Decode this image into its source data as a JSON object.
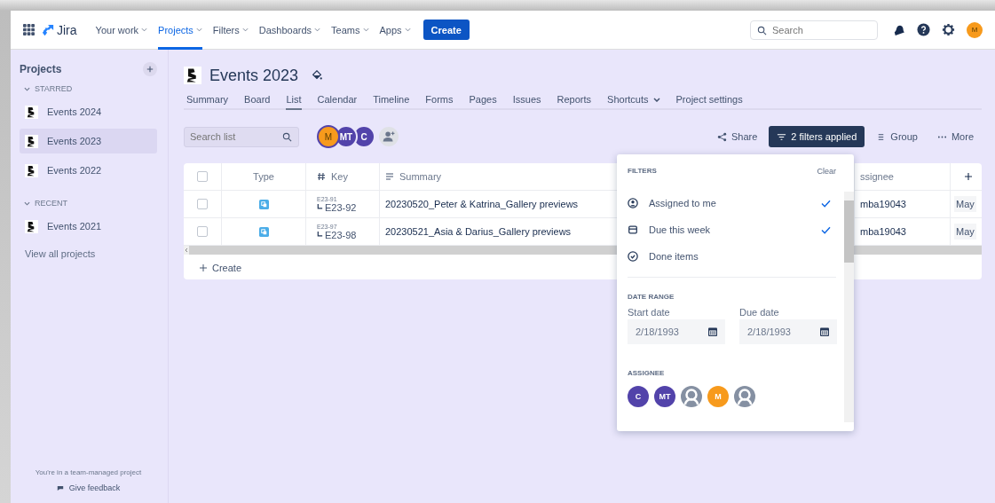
{
  "nav": {
    "product": "Jira",
    "items": [
      {
        "label": "Your work",
        "selected": false
      },
      {
        "label": "Projects",
        "selected": true
      },
      {
        "label": "Filters",
        "selected": false
      },
      {
        "label": "Dashboards",
        "selected": false
      },
      {
        "label": "Teams",
        "selected": false
      },
      {
        "label": "Apps",
        "selected": false
      }
    ],
    "create": "Create",
    "search": {
      "placeholder": "Search"
    },
    "user": {
      "initials": "M",
      "color": "#f79a1c"
    }
  },
  "sidebar": {
    "title": "Projects",
    "sections": [
      {
        "label": "STARRED",
        "expanded": true,
        "items": [
          {
            "name": "Events 2024",
            "selected": false
          },
          {
            "name": "Events 2023",
            "selected": true
          },
          {
            "name": "Events 2022",
            "selected": false
          }
        ]
      },
      {
        "label": "RECENT",
        "expanded": true,
        "items": [
          {
            "name": "Events 2021",
            "selected": false
          }
        ]
      }
    ],
    "view_all": "View all projects",
    "footer_note": "You're in a team-managed project",
    "feedback": "Give feedback"
  },
  "project": {
    "title": "Events 2023",
    "tabs": [
      {
        "label": "Summary",
        "selected": false,
        "kind": "plain"
      },
      {
        "label": "Board",
        "selected": false,
        "kind": "plain"
      },
      {
        "label": "List",
        "selected": true,
        "kind": "plain"
      },
      {
        "label": "Calendar",
        "selected": false,
        "kind": "plain"
      },
      {
        "label": "Timeline",
        "selected": false,
        "kind": "plain"
      },
      {
        "label": "Forms",
        "selected": false,
        "kind": "plain"
      },
      {
        "label": "Pages",
        "selected": false,
        "kind": "plain"
      },
      {
        "label": "Issues",
        "selected": false,
        "kind": "plain"
      },
      {
        "label": "Reports",
        "selected": false,
        "kind": "plain"
      },
      {
        "label": "Shortcuts",
        "selected": false,
        "kind": "dropdown"
      },
      {
        "label": "Project settings",
        "selected": false,
        "kind": "plain"
      }
    ]
  },
  "toolbar": {
    "search": {
      "placeholder": "Search list"
    },
    "avatars": [
      {
        "initials": "M",
        "color": "#f79a1c"
      },
      {
        "initials": "MT",
        "color": "#5243aa"
      },
      {
        "initials": "C",
        "color": "#5243aa"
      }
    ],
    "share": "Share",
    "filters": "2 filters applied",
    "group": "Group",
    "more": "More"
  },
  "table": {
    "select_all_checked": false,
    "columns": [
      "Type",
      "Key",
      "Summary",
      "ssignee"
    ],
    "rows": [
      {
        "checked": false,
        "parent_key": "E23-91",
        "key": "E23-92",
        "summary": "20230520_Peter & Katrina_Gallery previews",
        "assignee": "mba19043",
        "column_6": "May"
      },
      {
        "checked": false,
        "parent_key": "E23-97",
        "key": "E23-98",
        "summary": "20230521_Asia & Darius_Gallery previews",
        "assignee": "mba19043",
        "column_6": "May"
      }
    ],
    "create": "Create"
  },
  "filter_panel": {
    "title": "FILTERS",
    "clear": "Clear",
    "options": [
      {
        "kind": "person",
        "label": "Assigned to me",
        "checked": true
      },
      {
        "kind": "calendar",
        "label": "Due this week",
        "checked": true
      },
      {
        "kind": "done",
        "label": "Done items",
        "checked": false
      }
    ],
    "date_range": {
      "title": "DATE RANGE",
      "start": {
        "label": "Start date",
        "value": "2/18/1993"
      },
      "due": {
        "label": "Due date",
        "value": "2/18/1993"
      }
    },
    "assignee": {
      "title": "ASSIGNEE",
      "avatars": [
        {
          "kind": "initials",
          "initials": "C",
          "color": "#5243aa"
        },
        {
          "kind": "initials",
          "initials": "MT",
          "color": "#5243aa"
        },
        {
          "kind": "generic",
          "color": "#8590a2"
        },
        {
          "kind": "initials",
          "initials": "M",
          "color": "#f79a1c"
        },
        {
          "kind": "generic",
          "color": "#8590a2"
        }
      ]
    }
  }
}
